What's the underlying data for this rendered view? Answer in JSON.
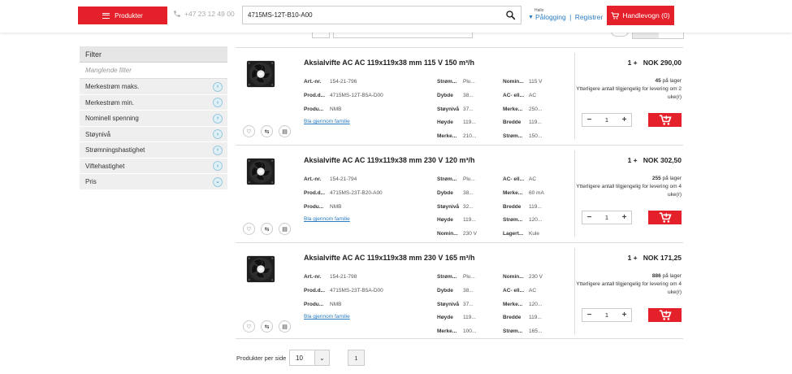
{
  "header": {
    "products_label": "Produkter",
    "phone": "+47 23 12 49 00",
    "search_value": "4715MS-12T-B10-A00",
    "greeting": "Hallo",
    "login_label": "Pålogging",
    "login_separator": " | ",
    "register_label": "Registrer",
    "cart_label": "Handlevogn (0)"
  },
  "filter": {
    "title": "Filter",
    "missing_label": "Manglende filter",
    "items": [
      {
        "label": "Merkestrøm maks.",
        "icon": "chevron-right-icon"
      },
      {
        "label": "Merkestrøm min.",
        "icon": "chevron-right-icon"
      },
      {
        "label": "Nominell spenning",
        "icon": "chevron-right-icon"
      },
      {
        "label": "Støynivå",
        "icon": "chevron-right-icon"
      },
      {
        "label": "Strømningshastighet",
        "icon": "chevron-right-icon"
      },
      {
        "label": "Viftehastighet",
        "icon": "chevron-right-icon"
      },
      {
        "label": "Pris",
        "icon": "chevron-down-icon"
      }
    ]
  },
  "products": [
    {
      "title": "Aksialvifte AC AC 119x119x38 mm 115 V 150 m³/h",
      "family_link": "Bla gjennom familie",
      "price_qty": "1 +",
      "price": "NOK 290,00",
      "stock_count": "45",
      "stock_text": " på lager",
      "availability": "Ytterligere antall tilgjengelig for levering om 2 uke(r)",
      "quantity": "1",
      "specs": {
        "col1": [
          {
            "k": "Art.-nr.",
            "v": "154-21-796"
          },
          {
            "k": "Prod.d...",
            "v": "4715MS-12T-B5A-D00"
          },
          {
            "k": "Produ...",
            "v": "NMB"
          }
        ],
        "col2": [
          {
            "k": "Strøm...",
            "v": "Plu..."
          },
          {
            "k": "Dybde",
            "v": "38..."
          },
          {
            "k": "Støynivå",
            "v": "37..."
          },
          {
            "k": "Høyde",
            "v": "119..."
          },
          {
            "k": "Merke...",
            "v": "210..."
          }
        ],
        "col3": [
          {
            "k": "Nomin...",
            "v": "115 V"
          },
          {
            "k": "AC- ell...",
            "v": "AC"
          },
          {
            "k": "Merke...",
            "v": "250..."
          },
          {
            "k": "Bredde",
            "v": "119..."
          },
          {
            "k": "Strøm...",
            "v": "150..."
          }
        ]
      }
    },
    {
      "title": "Aksialvifte AC AC 119x119x38 mm 230 V 120 m³/h",
      "family_link": "Bla gjennom familie",
      "price_qty": "1 +",
      "price": "NOK 302,50",
      "stock_count": "255",
      "stock_text": " på lager",
      "availability": "Ytterligere antall tilgjengelig for levering om 4 uke(r)",
      "quantity": "1",
      "specs": {
        "col1": [
          {
            "k": "Art.-nr.",
            "v": "154-21-794"
          },
          {
            "k": "Prod.d...",
            "v": "4715MS-23T-B20-A00"
          },
          {
            "k": "Produ...",
            "v": "NMB"
          }
        ],
        "col2": [
          {
            "k": "Strøm...",
            "v": "Plu..."
          },
          {
            "k": "Dybde",
            "v": "38..."
          },
          {
            "k": "Støynivå",
            "v": "32..."
          },
          {
            "k": "Høyde",
            "v": "119..."
          },
          {
            "k": "Nomin...",
            "v": "230 V"
          }
        ],
        "col3": [
          {
            "k": "AC- ell...",
            "v": "AC"
          },
          {
            "k": "Merke...",
            "v": "60 mA"
          },
          {
            "k": "Bredde",
            "v": "119..."
          },
          {
            "k": "Strøm...",
            "v": "120..."
          },
          {
            "k": "Lagert...",
            "v": "Kule"
          }
        ]
      }
    },
    {
      "title": "Aksialvifte AC AC 119x119x38 mm 230 V 165 m³/h",
      "family_link": "Bla gjennom familie",
      "price_qty": "1 +",
      "price": "NOK 171,25",
      "stock_count": "886",
      "stock_text": " på lager",
      "availability": "Ytterligere antall tilgjengelig for levering om 4 uke(r)",
      "quantity": "1",
      "specs": {
        "col1": [
          {
            "k": "Art.-nr.",
            "v": "154-21-798"
          },
          {
            "k": "Prod.d...",
            "v": "4715MS-23T-B5A-D00"
          },
          {
            "k": "Produ...",
            "v": "NMB"
          }
        ],
        "col2": [
          {
            "k": "Strøm...",
            "v": "Plu..."
          },
          {
            "k": "Dybde",
            "v": "38..."
          },
          {
            "k": "Støynivå",
            "v": "37..."
          },
          {
            "k": "Høyde",
            "v": "119..."
          },
          {
            "k": "Merke...",
            "v": "100..."
          }
        ],
        "col3": [
          {
            "k": "Nomin...",
            "v": "230 V"
          },
          {
            "k": "AC- ell...",
            "v": "AC"
          },
          {
            "k": "Merke...",
            "v": "120..."
          },
          {
            "k": "Bredde",
            "v": "119..."
          },
          {
            "k": "Strøm...",
            "v": "165..."
          }
        ]
      }
    }
  ],
  "pager": {
    "per_page_label": "Produkter per side",
    "per_page_value": "10",
    "current_page": "1"
  },
  "colors": {
    "brand_red": "#e4202a",
    "link_blue": "#2a7bbf"
  }
}
